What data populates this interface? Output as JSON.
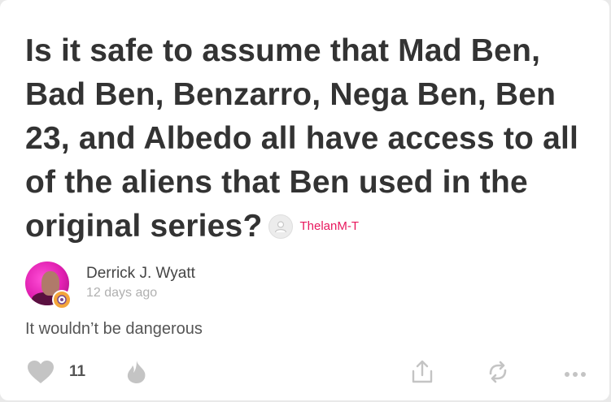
{
  "question": {
    "text": "Is it safe to assume that Mad Ben, Bad Ben, Benzarro, Nega Ben, Ben 23, and Albedo all have access to all of the aliens that Ben used in the original series?",
    "asker_name": "ThelanM-T"
  },
  "answer": {
    "author_name": "Derrick J. Wyatt",
    "time_ago": "12 days ago",
    "text": "It wouldn’t be dangerous",
    "like_count": "11"
  },
  "colors": {
    "accent": "#e8175d",
    "icon_gray": "#c4c4c4"
  },
  "icons": {
    "like": "heart-icon",
    "upvote": "flame-icon",
    "share": "share-icon",
    "repost": "repost-icon",
    "more": "more-icon"
  }
}
